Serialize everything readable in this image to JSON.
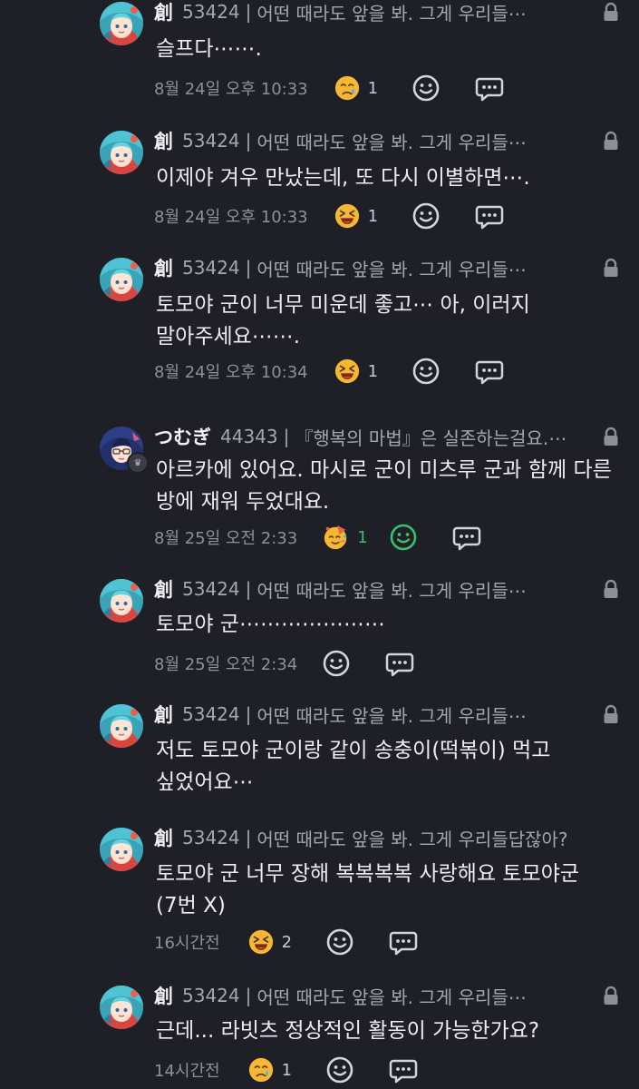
{
  "comments": [
    {
      "author": "創",
      "uid": "53424",
      "separator": "|",
      "status": "어떤 때라도 앞을 봐. 그게 우리들⋯",
      "lines": [
        "슬프다⋯⋯."
      ],
      "time": "8월 24일 오후 10:33",
      "reaction": {
        "emoji": "sad-face",
        "count": "1"
      },
      "avatar": "aqua-hair-avatar"
    },
    {
      "author": "創",
      "uid": "53424",
      "separator": "|",
      "status": "어떤 때라도 앞을 봐. 그게 우리들⋯",
      "lines": [
        "이제야 겨우 만났는데, 또 다시 이별하면⋯."
      ],
      "time": "8월 24일 오후 10:33",
      "reaction": {
        "emoji": "squint-laugh-face",
        "count": "1"
      },
      "avatar": "aqua-hair-avatar"
    },
    {
      "author": "創",
      "uid": "53424",
      "separator": "|",
      "status": "어떤 때라도 앞을 봐. 그게 우리들⋯",
      "lines": [
        "토모야 군이 너무 미운데 좋고⋯ 아, 이러지",
        "말아주세요⋯⋯."
      ],
      "time": "8월 24일 오후 10:34",
      "reaction": {
        "emoji": "squint-laugh-face",
        "count": "1"
      },
      "avatar": "aqua-hair-avatar"
    },
    {
      "author": "つむぎ",
      "uid": "44343",
      "separator": "|",
      "status": "『행복의 마법』은 실존하는걸요.⋯",
      "lines": [
        "아르카에 있어요. 마시로 군이 미츠루 군과 함께 다른",
        "방에 재워 두었대요."
      ],
      "time": "8월 25일 오전 2:33",
      "reaction": {
        "emoji": "party-face",
        "count": "1"
      },
      "avatar": "dark-hair-glasses-avatar"
    },
    {
      "author": "創",
      "uid": "53424",
      "separator": "|",
      "status": "어떤 때라도 앞을 봐. 그게 우리들⋯",
      "lines": [
        "토모야 군⋯⋯⋯⋯⋯⋯⋯"
      ],
      "time": "8월 25일 오전 2:34",
      "avatar": "aqua-hair-avatar"
    },
    {
      "author": "創",
      "uid": "53424",
      "separator": "|",
      "status": "어떤 때라도 앞을 봐. 그게 우리들⋯",
      "lines": [
        "저도 토모야 군이랑 같이 송충이(떡볶이) 먹고",
        "싶었어요⋯"
      ],
      "avatar": "aqua-hair-avatar"
    },
    {
      "author": "創",
      "uid": "53424",
      "separator": "|",
      "status": "어떤 때라도 앞을 봐. 그게 우리들답잖아?",
      "lines": [
        "토모야 군 너무 장해 복복복복 사랑해요 토모야군",
        "(7번 X)"
      ],
      "time": "16시간전",
      "reaction": {
        "emoji": "squint-laugh-face",
        "count": "2"
      },
      "avatar": "aqua-hair-avatar"
    },
    {
      "author": "創",
      "uid": "53424",
      "separator": "|",
      "status": "어떤 때라도 앞을 봐. 그게 우리들⋯",
      "lines": [
        "근데... 라빗츠 정상적인 활동이 가능한가요?"
      ],
      "time": "14시간전",
      "reaction": {
        "emoji": "sad-face",
        "count": "1"
      },
      "avatar": "aqua-hair-avatar"
    }
  ],
  "icons": {
    "add_reaction": "smile-outline-icon",
    "reply": "chat-bubble-icon",
    "lock": "lock-icon"
  },
  "colors": {
    "background": "#1e1f27",
    "reacted_green": "#35c26b",
    "emoji_yellow": "#f6b833"
  }
}
